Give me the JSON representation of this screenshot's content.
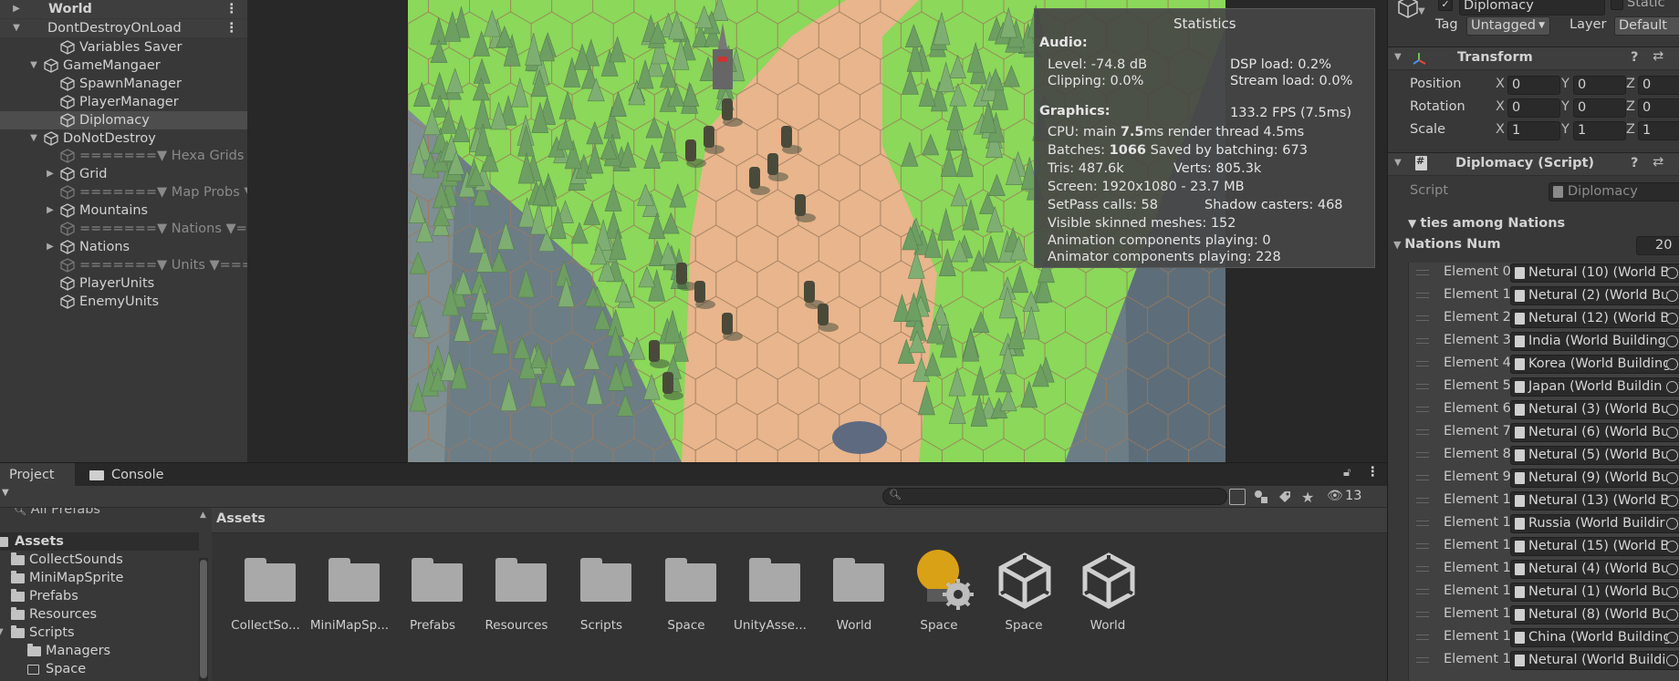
{
  "hierarchy": {
    "scene_world": "World",
    "scene_dontdestroy": "DontDestroyOnLoad",
    "items": [
      {
        "label": "Variables Saver"
      },
      {
        "label": "GameMangaer"
      },
      {
        "label": "SpawnManager"
      },
      {
        "label": "PlayerManager"
      },
      {
        "label": "Diplomacy"
      },
      {
        "label": "DoNotDestroy"
      },
      {
        "label": "=======▼ Hexa Grids ▼"
      },
      {
        "label": "Grid"
      },
      {
        "label": "=======▼ Map Probs ▼"
      },
      {
        "label": "Mountains"
      },
      {
        "label": "=======▼ Nations ▼=="
      },
      {
        "label": "Nations"
      },
      {
        "label": "=======▼ Units ▼===="
      },
      {
        "label": "PlayerUnits"
      },
      {
        "label": "EnemyUnits"
      }
    ]
  },
  "stats": {
    "title": "Statistics",
    "audio_header": "Audio:",
    "level": "Level: -74.8 dB",
    "clipping": "Clipping: 0.0%",
    "dsp": "DSP load: 0.2%",
    "stream": "Stream load: 0.0%",
    "graphics_header": "Graphics:",
    "fps": "133.2 FPS (7.5ms)",
    "cpu_prefix": "CPU: main ",
    "cpu_main": "7.5",
    "cpu_suffix": "ms  render thread 4.5ms",
    "batches_prefix": "Batches: ",
    "batches": "1066",
    "batches_suffix": "  Saved by batching: 673",
    "tris": "Tris: 487.6k",
    "verts": "Verts: 805.3k",
    "screen": "Screen: 1920x1080 - 23.7 MB",
    "setpass": "SetPass calls: 58",
    "shadow": "Shadow casters: 468",
    "skinned": "Visible skinned meshes: 152",
    "anim": "Animation components playing: 0",
    "animator": "Animator components playing: 228"
  },
  "inspector": {
    "object_name": "Diplomacy",
    "static_label": "Static",
    "tag_label": "Tag",
    "tag_value": "Untagged",
    "layer_label": "Layer",
    "layer_value": "Default",
    "transform_title": "Transform",
    "position_label": "Position",
    "rotation_label": "Rotation",
    "scale_label": "Scale",
    "axis_x": "X",
    "axis_y": "Y",
    "axis_z": "Z",
    "position": [
      "0",
      "0",
      "0"
    ],
    "rotation": [
      "0",
      "0",
      "0"
    ],
    "scale": [
      "1",
      "1",
      "1"
    ],
    "script_component_title": "Diplomacy (Script)",
    "script_label": "Script",
    "script_value": "Diplomacy",
    "relations_header": "ties among Nations",
    "nations_num_label": "Nations Num",
    "nations_num_value": "20",
    "elements": [
      {
        "label": "Element 0",
        "value": "Netural (10) (World B"
      },
      {
        "label": "Element 1",
        "value": "Netural (2) (World Bu"
      },
      {
        "label": "Element 2",
        "value": "Netural (12) (World B"
      },
      {
        "label": "Element 3",
        "value": "India (World Building"
      },
      {
        "label": "Element 4",
        "value": "Korea (World Building"
      },
      {
        "label": "Element 5",
        "value": "Japan (World Buildin"
      },
      {
        "label": "Element 6",
        "value": "Netural (3) (World Bu"
      },
      {
        "label": "Element 7",
        "value": "Netural (6) (World Bu"
      },
      {
        "label": "Element 8",
        "value": "Netural (5) (World Bu"
      },
      {
        "label": "Element 9",
        "value": "Netural (9) (World Bu"
      },
      {
        "label": "Element 1",
        "value": "Netural (13) (World B"
      },
      {
        "label": "Element 1",
        "value": "Russia (World Buildir"
      },
      {
        "label": "Element 1",
        "value": "Netural (15) (World B"
      },
      {
        "label": "Element 1",
        "value": "Netural (4) (World Bu"
      },
      {
        "label": "Element 1",
        "value": "Netural (1) (World Bu"
      },
      {
        "label": "Element 1",
        "value": "Netural (8) (World Bu"
      },
      {
        "label": "Element 1",
        "value": "China (World Building"
      },
      {
        "label": "Element 1",
        "value": "Netural (World Buildi"
      }
    ]
  },
  "tabs": {
    "project": "Project",
    "console": "Console"
  },
  "project": {
    "hidden_count": "13",
    "partial_top_item": "All Prefabs",
    "root": "Assets",
    "breadcrumb": "Assets",
    "tree": [
      "CollectSounds",
      "MiniMapSprite",
      "Prefabs",
      "Resources",
      "Scripts",
      "Managers",
      "Space"
    ],
    "assets": [
      {
        "label": "CollectSo...",
        "kind": "folder"
      },
      {
        "label": "MiniMapSp...",
        "kind": "folder"
      },
      {
        "label": "Prefabs",
        "kind": "folder"
      },
      {
        "label": "Resources",
        "kind": "folder"
      },
      {
        "label": "Scripts",
        "kind": "folder"
      },
      {
        "label": "Space",
        "kind": "folder"
      },
      {
        "label": "UnityAsse...",
        "kind": "folder"
      },
      {
        "label": "World",
        "kind": "folder"
      },
      {
        "label": "Space",
        "kind": "lighting"
      },
      {
        "label": "Space",
        "kind": "unity-scene"
      },
      {
        "label": "World",
        "kind": "unity-scene"
      }
    ]
  },
  "colors": {
    "panel": "#383838",
    "dark": "#282828",
    "selection": "#4d4d4d",
    "hex_sand": "#e8b58c",
    "hex_green": "#8bd85a",
    "tree_green": "#6d9e62"
  }
}
